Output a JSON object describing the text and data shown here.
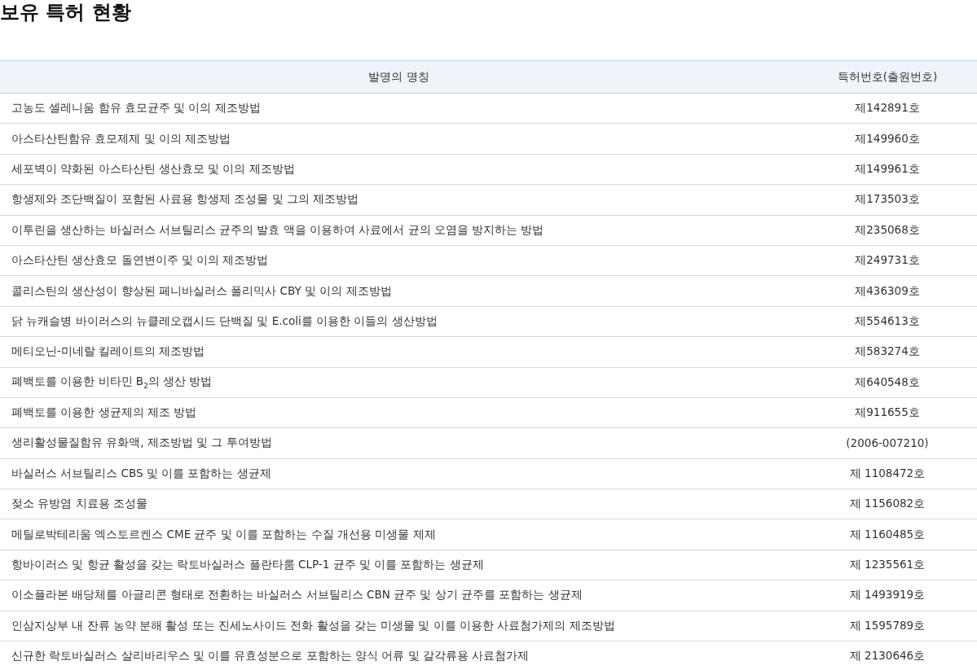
{
  "title": "보유 특허 현황",
  "table": {
    "columns": [
      "발명의 명칭",
      "특허번호(출원번호)"
    ],
    "rows": [
      {
        "name": "고농도 셀레니움 함유 효모균주 및 이의 제조방법",
        "number": "제142891호"
      },
      {
        "name": "아스타산틴함유 효모제제 및 이의 제조방법",
        "number": "제149960호"
      },
      {
        "name": "세포벽이 약화된 아스타산틴 생산효모 및 이의 제조방법",
        "number": "제149961호"
      },
      {
        "name": "항생제와 조단백질이 포함된 사료용 항생제 조성물 및 그의 제조방법",
        "number": "제173503호"
      },
      {
        "name": "이투린을 생산하는 바실러스 서브틸리스 균주의 발효 액을 이용하여 사료에서 균의 오염을 방지하는 방법",
        "number": "제235068호"
      },
      {
        "name": "아스타산틴 생산효모 돌연변이주 및 이의 제조방법",
        "number": "제249731호"
      },
      {
        "name": "콜리스틴의 생산성이 향상된 페니바실러스 폴리믹사 CBY 및 이의 제조방법",
        "number": "제436309호"
      },
      {
        "name": "닭 뉴캐슬병 바이러스의 뉴클레오캡시드 단백질 및 E.coli를 이용한 이들의 생산방법",
        "number": "제554613호"
      },
      {
        "name": "메티오닌-미네랄 킬레이트의 제조방법",
        "number": "제583274호"
      },
      {
        "name": "폐백토를 이용한 비타민 B$_{2}$의 생산 방법",
        "number": "제640548호"
      },
      {
        "name": "폐백토를 이용한 생균제의 제조 방법",
        "number": "제911655호"
      },
      {
        "name": "생리활성물질함유 유화액, 제조방법 및 그 투여방법",
        "number": "(2006-007210)"
      },
      {
        "name": "바실러스 서브틸리스 CBS 및 이를 포함하는 생균제",
        "number": "제 1108472호"
      },
      {
        "name": "젖소 유방염 치료용 조성물",
        "number": "제 1156082호"
      },
      {
        "name": "메틸로박테리움 엑스토르켄스 CME 균주 및 이를 포함하는 수질 개선용 미생물 제제",
        "number": "제 1160485호"
      },
      {
        "name": "항바이러스 및 항균 활성을 갖는 락토바실러스 플란타룸 CLP-1 균주 및 이를 포함하는 생균제",
        "number": "제 1235561호"
      },
      {
        "name": "이소플라본 배당체를 아글리콘 형태로 전환하는 바실러스 서브틸리스 CBN 균주 및 상기 균주를 포함하는 생균제",
        "number": "제 1493919호"
      },
      {
        "name": "인삼지상부 내 잔류 농약 분해 활성 또는 진세노사이드 전화 활성을 갖는 미생물 및 이를 이용한 사료첨가제의 제조방법",
        "number": "제 1595789호"
      },
      {
        "name": "신규한 락토바실러스 살리바리우스 및 이를 유효성분으로 포함하는 양식 어류 및 갈각류용 사료첨가제",
        "number": "제 2130646호"
      }
    ]
  }
}
